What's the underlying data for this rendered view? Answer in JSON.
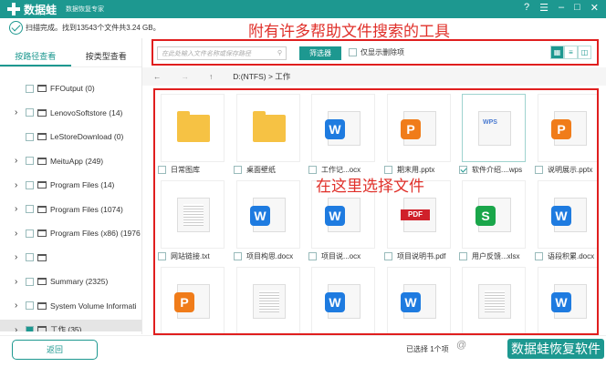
{
  "app": {
    "name": "数据蛙",
    "subtitle": "数据恢复专家"
  },
  "status": "扫描完成。找到13543个文件共3.24 GB。",
  "annotations": {
    "toolbar": "附有许多帮助文件搜索的工具",
    "grid": "在这里选择文件"
  },
  "tabs": [
    {
      "label": "按路径查看",
      "active": true
    },
    {
      "label": "按类型查看",
      "active": false
    }
  ],
  "tree": [
    {
      "label": "FFOutput (0)",
      "expandable": false
    },
    {
      "label": "LenovoSoftstore (14)",
      "expandable": true
    },
    {
      "label": "LeStoreDownload (0)",
      "expandable": false
    },
    {
      "label": "MeituApp (249)",
      "expandable": true
    },
    {
      "label": "Program Files (14)",
      "expandable": true
    },
    {
      "label": "Program Files (1074)",
      "expandable": true
    },
    {
      "label": "Program Files (x86) (1976",
      "expandable": true
    },
    {
      "label": "",
      "expandable": true
    },
    {
      "label": "Summary (2325)",
      "expandable": true
    },
    {
      "label": "System Volume Informati",
      "expandable": true
    },
    {
      "label": "工作 (35)",
      "expandable": true,
      "selected": true
    }
  ],
  "toolbar": {
    "search_placeholder": "在此处输入文件名称或保存路径",
    "filter_label": "筛选器",
    "deleted_only_label": "仅显示删除项"
  },
  "nav": {
    "back": "←",
    "forward": "→",
    "up": "↑",
    "path": "D:(NTFS) > 工作"
  },
  "files": [
    {
      "name": "日常图库",
      "type": "folder"
    },
    {
      "name": "桌面壁纸",
      "type": "folder"
    },
    {
      "name": "工作记...ocx",
      "type": "W"
    },
    {
      "name": "期末用.pptx",
      "type": "P"
    },
    {
      "name": "软件介绍....wps",
      "type": "WPS",
      "checked": true
    },
    {
      "name": "说明展示.pptx",
      "type": "P"
    },
    {
      "name": "网站链接.txt",
      "type": "txt"
    },
    {
      "name": "项目构思.docx",
      "type": "W"
    },
    {
      "name": "项目说...ocx",
      "type": "W"
    },
    {
      "name": "项目说明书.pdf",
      "type": "PDF"
    },
    {
      "name": "用户反馈...xlsx",
      "type": "S"
    },
    {
      "name": "语段积累.docx",
      "type": "W"
    },
    {
      "name": "",
      "type": "P"
    },
    {
      "name": "",
      "type": "txt"
    },
    {
      "name": "",
      "type": "W"
    },
    {
      "name": "",
      "type": "W"
    },
    {
      "name": "",
      "type": "txt"
    },
    {
      "name": "",
      "type": "W"
    }
  ],
  "footer": {
    "back_label": "返回",
    "selected_count": "已选择 1个项",
    "watermark": "数据蛙恢复软件",
    "watermark_prefix": "@"
  },
  "colors": {
    "accent": "#1d9890",
    "annotation": "#e01e1e",
    "W": "#1e7be0",
    "P": "#f07c1a",
    "S": "#1aa64a"
  }
}
